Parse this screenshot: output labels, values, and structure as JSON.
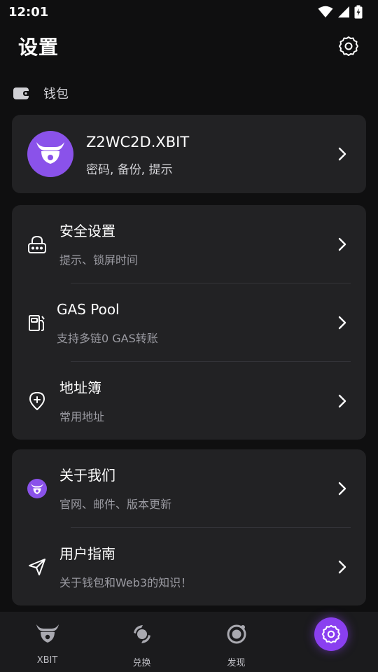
{
  "status_bar": {
    "time": "12:01"
  },
  "header": {
    "title": "设置"
  },
  "wallet_section": {
    "label": "钱包"
  },
  "wallet_card": {
    "name": "Z2WC2D.XBIT",
    "subtitle": "密码, 备份, 提示"
  },
  "settings": [
    {
      "title": "安全设置",
      "subtitle": "提示、锁屏时间",
      "icon": "lock-icon"
    },
    {
      "title": "GAS Pool",
      "subtitle": "支持多链0 GAS转账",
      "icon": "gas-station-icon"
    },
    {
      "title": "地址簿",
      "subtitle": "常用地址",
      "icon": "address-book-icon"
    }
  ],
  "about": [
    {
      "title": "关于我们",
      "subtitle": "官网、邮件、版本更新",
      "icon": "xbit-logo-icon"
    },
    {
      "title": "用户指南",
      "subtitle": "关于钱包和Web3的知识！",
      "icon": "paper-plane-icon"
    }
  ],
  "bottom_nav": [
    {
      "label": "XBIT",
      "icon": "xbit-bull-icon",
      "active": false
    },
    {
      "label": "兑换",
      "icon": "swap-icon",
      "active": false
    },
    {
      "label": "发现",
      "icon": "discover-icon",
      "active": false
    },
    {
      "label": "",
      "icon": "settings-gear-icon",
      "active": true
    }
  ],
  "colors": {
    "accent": "#8a52ea",
    "background": "#0f0f10",
    "card": "#222224"
  }
}
